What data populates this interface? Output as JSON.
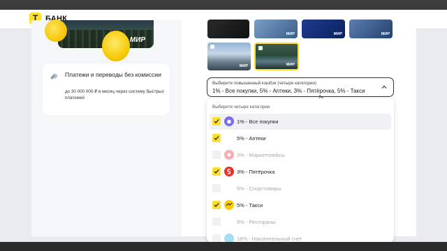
{
  "bank": {
    "logo_letter": "Т",
    "name": "БАНК"
  },
  "promo_card": {
    "brand": "МИР"
  },
  "info_box": {
    "title": "Платежи и переводы без комиссии",
    "subtitle": "до 30 000 000 ₽ в месяц через систему быстрых платежей"
  },
  "card_designs": [
    {
      "brand": "",
      "selected": false
    },
    {
      "brand": "МИР",
      "selected": false
    },
    {
      "brand": "МИР",
      "selected": false
    },
    {
      "brand": "МИР",
      "selected": false
    },
    {
      "brand": "МИР",
      "selected": false
    },
    {
      "brand": "МИР",
      "selected": true
    }
  ],
  "cashback_select": {
    "label": "Выберите повышенный кэшбэк (четыре категории)",
    "value": "1% - Все покупки, 5% - Аптеки, 3% - Пятёрочка, 5% - Такси"
  },
  "dropdown": {
    "header": "Выберите четыре категории",
    "options": [
      {
        "label": "1% - Все покупки",
        "checked": true,
        "disabled": false,
        "highlighted": true,
        "icon": "shopping-bag-icon",
        "icon_color": "#7b6cf0"
      },
      {
        "label": "5% - Аптеки",
        "checked": true,
        "disabled": false,
        "highlighted": false,
        "icon": "",
        "icon_color": ""
      },
      {
        "label": "3% - Маркетплейсы",
        "checked": false,
        "disabled": true,
        "highlighted": false,
        "icon": "marketplace-icon",
        "icon_color": "#f04a5a"
      },
      {
        "label": "3% - Пятёрочка",
        "checked": true,
        "disabled": false,
        "highlighted": false,
        "icon": "pyaterochka-icon",
        "icon_color": "#e5332a"
      },
      {
        "label": "5% - Спорттовары",
        "checked": false,
        "disabled": true,
        "highlighted": false,
        "icon": "",
        "icon_color": ""
      },
      {
        "label": "5% - Такси",
        "checked": true,
        "disabled": false,
        "highlighted": false,
        "icon": "taxi-icon",
        "icon_color": "#ffcc00"
      },
      {
        "label": "5% - Рестораны",
        "checked": false,
        "disabled": true,
        "highlighted": false,
        "icon": "",
        "icon_color": ""
      },
      {
        "label": "18% - Накопительный счет",
        "checked": false,
        "disabled": true,
        "highlighted": false,
        "icon": "savings-icon",
        "icon_color": "#3fb3e0"
      }
    ]
  },
  "colors": {
    "accent": "#ffdd2d",
    "text": "#222222",
    "disabled_text": "#a8a8a8"
  }
}
